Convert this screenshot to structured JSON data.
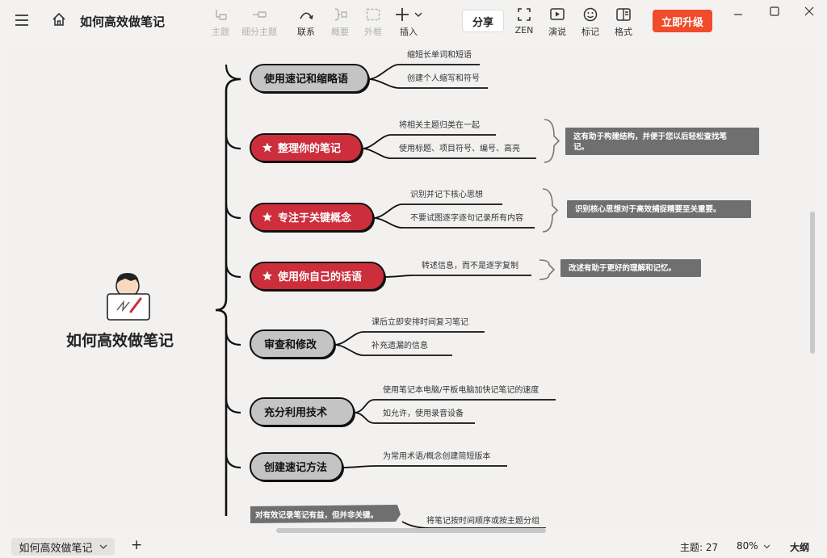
{
  "app": {
    "title": "如何高效做笔记",
    "menu_icon": "hamburger-menu-icon",
    "home_icon": "home-icon"
  },
  "toolbar": {
    "topic": "主题",
    "subtopic": "细分主题",
    "relation": "联系",
    "summary": "概要",
    "boundary": "外框",
    "insert": "插入",
    "share": "分享",
    "zen": "ZEN",
    "present": "演说",
    "mark": "标记",
    "format": "格式",
    "upgrade": "立即升级"
  },
  "colors": {
    "accent_red": "#f04b2a",
    "node_red": "#cc2e3c",
    "node_gray": "#c4c4c4",
    "callout_gray": "#6f6f6f"
  },
  "mindmap": {
    "central": "如何高效做笔记",
    "branches": [
      {
        "label": "使用速记和缩略语",
        "starred": false,
        "children": [
          "缩短长单词和短语",
          "创建个人缩写和符号"
        ]
      },
      {
        "label": "整理你的笔记",
        "starred": true,
        "children": [
          "将相关主题归类在一起",
          "使用标题、项目符号、编号、高亮"
        ],
        "callout": [
          "这有助于构建结构，并便于您以后轻松查找笔",
          "记。"
        ]
      },
      {
        "label": "专注于关键概念",
        "starred": true,
        "children": [
          "识别并记下核心思想",
          "不要试图逐字逐句记录所有内容"
        ],
        "callout": [
          "识别核心思想对于高效捕捉精要至关重要。"
        ]
      },
      {
        "label": "使用你自己的话语",
        "starred": true,
        "children": [
          "转述信息，而不是逐字复制"
        ],
        "callout": [
          "改述有助于更好的理解和记忆。"
        ]
      },
      {
        "label": "审查和修改",
        "starred": false,
        "children": [
          "课后立即安排时间复习笔记",
          "补充遗漏的信息"
        ]
      },
      {
        "label": "充分利用技术",
        "starred": false,
        "children": [
          "使用笔记本电脑/平板电脑加快记笔记的速度",
          "如允许，使用录音设备"
        ]
      },
      {
        "label": "创建速记方法",
        "starred": false,
        "children": [
          "为常用术语/概念创建简短版本"
        ]
      }
    ],
    "bottom_callout": "对有效记录笔记有益，但并非关键。",
    "bottom_child": "将笔记按时间顺序或按主题分组"
  },
  "bottombar": {
    "tab": "如何高效做笔记",
    "add": "+",
    "topics": "主题: 27",
    "zoom": "80%",
    "outline": "大纲"
  }
}
